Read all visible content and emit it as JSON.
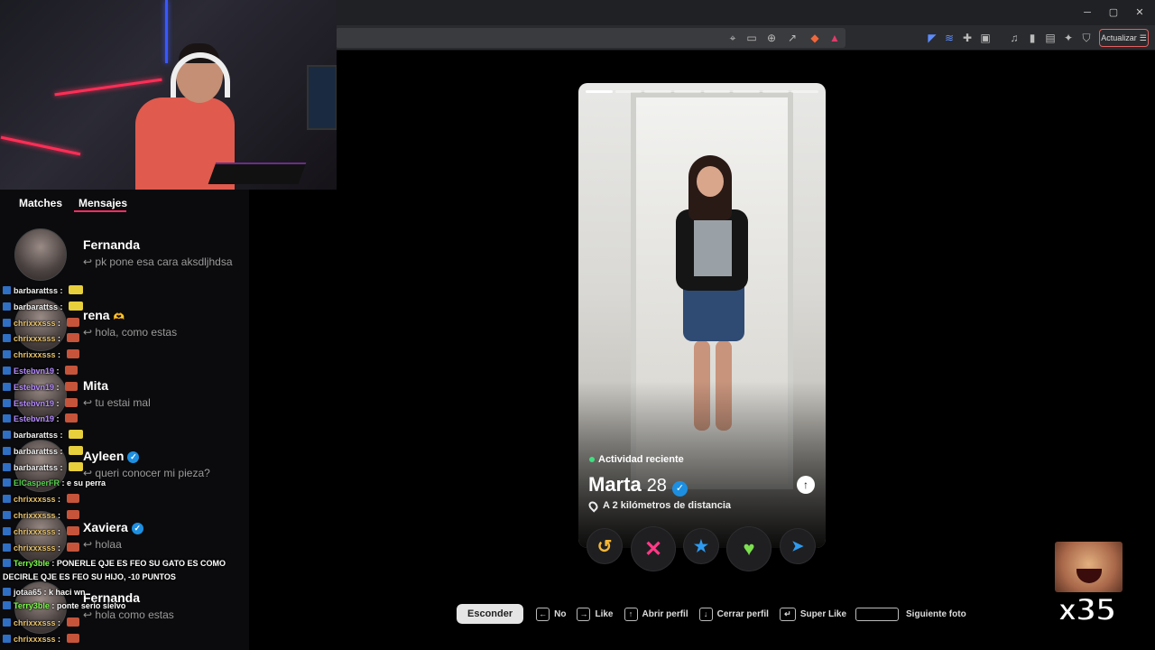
{
  "browser": {
    "update_label": "Actualizar",
    "window_controls": [
      "minimize-icon",
      "restore-icon",
      "close-icon"
    ]
  },
  "tinder": {
    "tabs": [
      {
        "label": "Matches"
      },
      {
        "label": "Mensajes"
      }
    ],
    "conversations": [
      {
        "name": "Fernanda",
        "message": "pk pone esa cara aksdljhdsa",
        "verified": false
      },
      {
        "name": "rena",
        "message": "hola, como estas",
        "verified": false,
        "emoji": "🫶"
      },
      {
        "name": "Mita",
        "message": "tu estai mal",
        "verified": false
      },
      {
        "name": "Ayleen",
        "message": "queri conocer mi pieza?",
        "verified": true
      },
      {
        "name": "Xaviera",
        "message": "holaa",
        "verified": true
      },
      {
        "name": "Fernanda",
        "message": "hola como estas",
        "verified": false
      }
    ],
    "profile": {
      "activity": "Actividad reciente",
      "name": "Marta",
      "age": "28",
      "distance": "A 2 kilómetros de distancia",
      "photo_count": 8
    },
    "actions": [
      "rewind-icon",
      "nope-icon",
      "super-like-icon",
      "like-icon",
      "boost-icon"
    ],
    "hints": {
      "hide": "Esconder",
      "no": "No",
      "like": "Like",
      "open": "Abrir perfil",
      "close": "Cerrar perfil",
      "super": "Super Like",
      "next": "Siguiente foto"
    }
  },
  "twitch_chat": [
    {
      "user": "barbarattss",
      "color": "#f0f0f0",
      "text": "",
      "emote": "pika"
    },
    {
      "user": "barbarattss",
      "color": "#f0f0f0",
      "text": "",
      "emote": "pika"
    },
    {
      "user": "chrixxxsss",
      "color": "#e7c26c",
      "text": "",
      "emote": "face"
    },
    {
      "user": "chrixxxsss",
      "color": "#e7c26c",
      "text": "",
      "emote": "face"
    },
    {
      "user": "chrixxxsss",
      "color": "#e7c26c",
      "text": "",
      "emote": "face"
    },
    {
      "user": "Estebvn19",
      "color": "#b58cff",
      "text": "",
      "emote": "face"
    },
    {
      "user": "Estebvn19",
      "color": "#b58cff",
      "text": "",
      "emote": "face"
    },
    {
      "user": "Estebvn19",
      "color": "#b58cff",
      "text": "",
      "emote": "face"
    },
    {
      "user": "Estebvn19",
      "color": "#b58cff",
      "text": "",
      "emote": "face"
    },
    {
      "user": "barbarattss",
      "color": "#f0f0f0",
      "text": "",
      "emote": "pika"
    },
    {
      "user": "barbarattss",
      "color": "#f0f0f0",
      "text": "",
      "emote": "pika"
    },
    {
      "user": "barbarattss",
      "color": "#f0f0f0",
      "text": "",
      "emote": "pika"
    },
    {
      "user": "ElCasperFR",
      "color": "#57d14f",
      "text": "e su perra",
      "emote": ""
    },
    {
      "user": "chrixxxsss",
      "color": "#e7c26c",
      "text": "",
      "emote": "face"
    },
    {
      "user": "chrixxxsss",
      "color": "#e7c26c",
      "text": "",
      "emote": "face"
    },
    {
      "user": "chrixxxsss",
      "color": "#e7c26c",
      "text": "",
      "emote": "face"
    },
    {
      "user": "chrixxxsss",
      "color": "#e7c26c",
      "text": "",
      "emote": "face"
    },
    {
      "user": "Terry3ble",
      "color": "#7cff4a",
      "text": "PONERLE QJE ES FEO SU GATO ES COMO",
      "emote": ""
    },
    {
      "user": "",
      "color": "#f0f0f0",
      "text": "DECIRLE QJE ES FEO SU HIJO, -10 PUNTOS",
      "emote": ""
    },
    {
      "user": "jotaa65",
      "color": "#f0f0f0",
      "text": "k haci wn",
      "emote": ""
    },
    {
      "user": "Terry3ble",
      "color": "#7cff4a",
      "text": "ponte serio sielvo",
      "emote": ""
    },
    {
      "user": "chrixxxsss",
      "color": "#e7c26c",
      "text": "",
      "emote": "face"
    },
    {
      "user": "chrixxxsss",
      "color": "#e7c26c",
      "text": "",
      "emote": "face"
    }
  ],
  "emote_overlay": {
    "count": "x35"
  },
  "colors": {
    "tinder_accent": "#fd2d63",
    "like_green": "#7ce04f",
    "super_blue": "#2d9bf0"
  }
}
